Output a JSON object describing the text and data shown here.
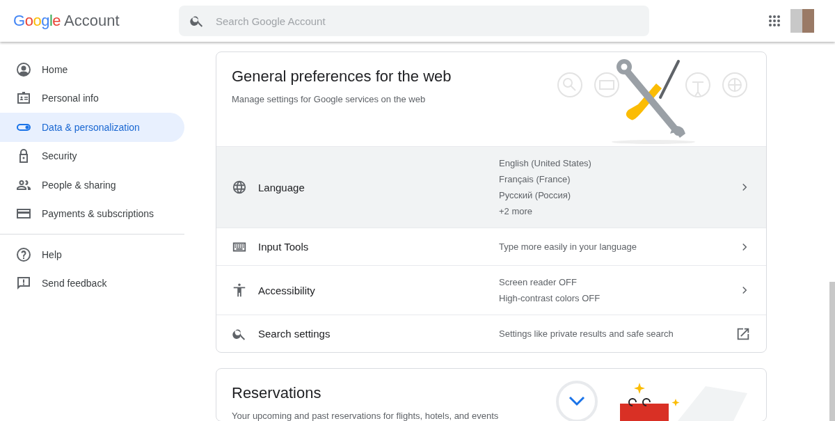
{
  "header": {
    "logo_brand": "Google",
    "logo_product": "Account",
    "search": {
      "placeholder": "Search Google Account"
    }
  },
  "sidebar": {
    "items": [
      {
        "label": "Home",
        "selected": false
      },
      {
        "label": "Personal info",
        "selected": false
      },
      {
        "label": "Data & personalization",
        "selected": true
      },
      {
        "label": "Security",
        "selected": false
      },
      {
        "label": "People & sharing",
        "selected": false
      },
      {
        "label": "Payments & subscriptions",
        "selected": false
      }
    ],
    "footer_items": [
      {
        "label": "Help"
      },
      {
        "label": "Send feedback"
      }
    ]
  },
  "cards": [
    {
      "title": "General preferences for the web",
      "subtitle": "Manage settings for Google services on the web",
      "kind": "tools",
      "rows": [
        {
          "label": "Language",
          "values": [
            "English (United States)",
            "Français (France)",
            "Русский (Россия)",
            "+2 more"
          ],
          "kind": "chevron",
          "highlighted": true
        },
        {
          "label": "Input Tools",
          "values": [
            "Type more easily in your language"
          ],
          "kind": "chevron",
          "highlighted": false
        },
        {
          "label": "Accessibility",
          "values": [
            "Screen reader OFF",
            "High-contrast colors OFF"
          ],
          "kind": "chevron",
          "highlighted": false
        },
        {
          "label": "Search settings",
          "values": [
            "Settings like private results and safe search"
          ],
          "kind": "external",
          "highlighted": false
        }
      ]
    },
    {
      "title": "Reservations",
      "subtitle": "Your upcoming and past reservations for flights, hotels, and events",
      "kind": "reservations"
    }
  ]
}
